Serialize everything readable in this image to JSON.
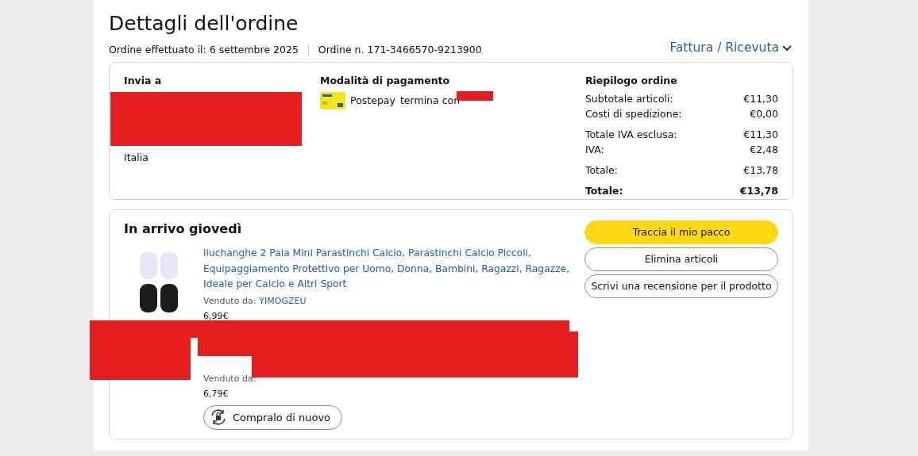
{
  "title": "Dettagli dell'ordine",
  "meta": [
    {
      "text": "Ordine effettuato il: 6 settembre 2025"
    },
    {
      "text": "Ordine n. 171-3466570-9213900"
    }
  ],
  "invoice_link": {
    "label": "Fattura / Ricevuta"
  },
  "ship_to": {
    "heading": "Invia a",
    "lines": [
      "Italia"
    ]
  },
  "payment": {
    "heading": "Modalità di pagamento",
    "method": "Postepay",
    "suffix": "termina con"
  },
  "summary": {
    "heading": "Riepilogo ordine",
    "rows": [
      {
        "kind": "line",
        "label": "Subtotale articoli:",
        "value": "€11,30"
      },
      {
        "kind": "line",
        "label": "Costi di spedizione:",
        "value": "€0,00"
      },
      {
        "kind": "group",
        "label": "Totale IVA esclusa:",
        "value": "€11,30"
      },
      {
        "kind": "line",
        "label": "IVA:",
        "value": "€2,48"
      },
      {
        "kind": "group",
        "label": "Totale:",
        "value": "€13,78"
      },
      {
        "kind": "total",
        "label": "Totale:",
        "value": "€13,78"
      }
    ]
  },
  "shipment": {
    "heading": "In arrivo giovedì",
    "items": [
      {
        "title": "liuchanghe 2 Paia Mini Parastinchi Calcio, Parastinchi Calcio Piccoli, Equipaggiamento Protettivo per Uomo, Donna, Bambini, Ragazzi, Ragazze, Ideale per Calcio e Altri Sport",
        "seller_label": "Venduto da:",
        "seller": "YIMOGZEU",
        "price": "6,99€"
      },
      {
        "seller_label": "Venduto da:",
        "price": "6,79€",
        "buy_again": "Compralo di nuovo"
      }
    ],
    "actions": [
      {
        "kind": "primary",
        "label": "Traccia il mio pacco"
      },
      {
        "kind": "secondary",
        "label": "Elimina articoli"
      },
      {
        "kind": "secondary",
        "label": "Scrivi una recensione per il prodotto"
      }
    ]
  }
}
